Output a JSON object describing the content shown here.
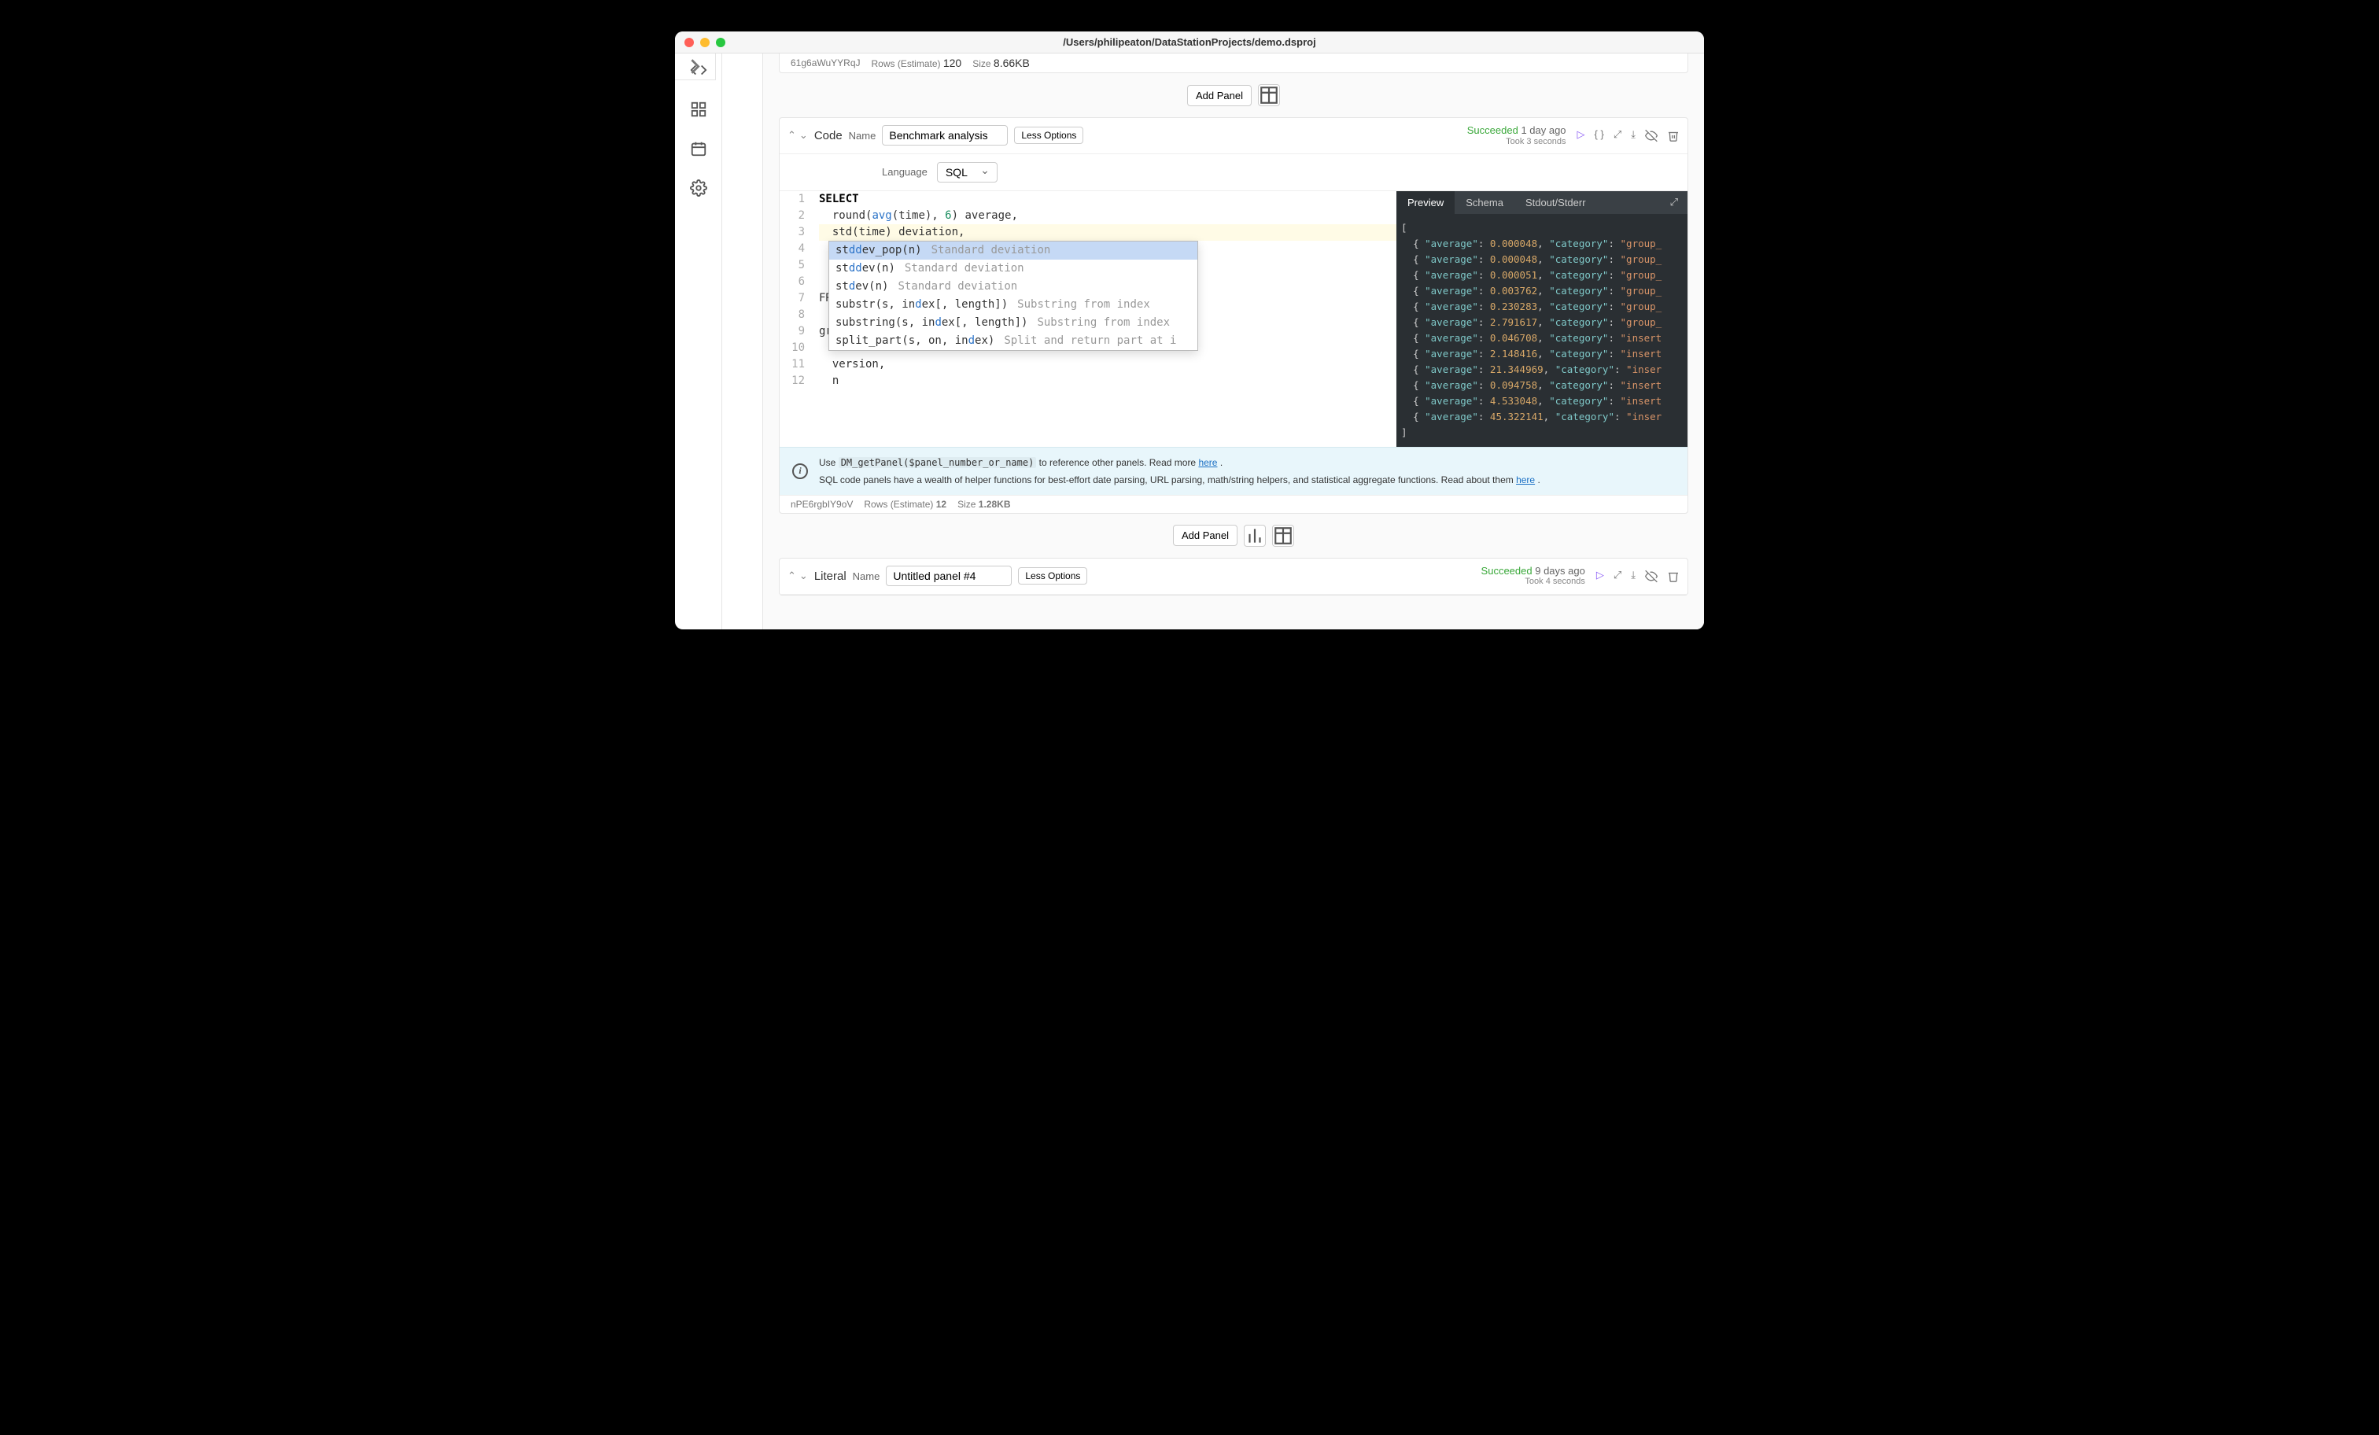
{
  "window_title": "/Users/philipeaton/DataStationProjects/demo.dsproj",
  "sidebar": {
    "icons": [
      "code-icon",
      "grid-icon",
      "calendar-icon",
      "gear-icon"
    ]
  },
  "prev_panel_footer": {
    "id": "61g6aWuYYRqJ",
    "rows_label": "Rows (Estimate)",
    "rows": "120",
    "size_label": "Size",
    "size": "8.66KB"
  },
  "add_panel_label": "Add Panel",
  "panel1": {
    "kind": "Code",
    "name_label": "Name",
    "name": "Benchmark analysis",
    "less_options": "Less Options",
    "status_ok": "Succeeded",
    "status_when": "1 day ago",
    "status_sub": "Took 3 seconds",
    "language_label": "Language",
    "language": "SQL",
    "code_lines": [
      "SELECT",
      "  round(avg(time), 6) average,",
      "  std(time) deviation,",
      "",
      "",
      "",
      "FR",
      "",
      "gr",
      "",
      "  version,",
      "  n"
    ],
    "autocomplete": [
      {
        "sig": "stddev_pop(n)",
        "match": "std",
        "desc": "Standard deviation"
      },
      {
        "sig": "stddev(n)",
        "match": "std",
        "desc": "Standard deviation"
      },
      {
        "sig": "stdev(n)",
        "match": "st",
        "desc": "Standard deviation"
      },
      {
        "sig": "substr(s, index[, length])",
        "match": "",
        "desc": "Substring from index"
      },
      {
        "sig": "substring(s, index[, length])",
        "match": "",
        "desc": "Substring from index"
      },
      {
        "sig": "split_part(s, on, index)",
        "match": "",
        "desc": "Split and return part at i"
      }
    ],
    "info1_pre": "Use ",
    "info1_code": "DM_getPanel($panel_number_or_name)",
    "info1_post": " to reference other panels. Read more ",
    "info1_link": "here",
    "info2": "SQL code panels have a wealth of helper functions for best-effort date parsing, URL parsing, math/string helpers, and statistical aggregate functions. Read about them ",
    "info2_link": "here",
    "preview_tabs": [
      "Preview",
      "Schema",
      "Stdout/Stderr"
    ],
    "preview_data": [
      {
        "average": 4.8e-05,
        "category": "group_"
      },
      {
        "average": 4.8e-05,
        "category": "group_"
      },
      {
        "average": 5.1e-05,
        "category": "group_"
      },
      {
        "average": 0.003762,
        "category": "group_"
      },
      {
        "average": 0.230283,
        "category": "group_"
      },
      {
        "average": 2.791617,
        "category": "group_"
      },
      {
        "average": 0.046708,
        "category": "insert"
      },
      {
        "average": 2.148416,
        "category": "insert"
      },
      {
        "average": 21.344969,
        "category": "inser"
      },
      {
        "average": 0.094758,
        "category": "insert"
      },
      {
        "average": 4.533048,
        "category": "insert"
      },
      {
        "average": 45.322141,
        "category": "inser"
      }
    ],
    "footer": {
      "id": "nPE6rgbIY9oV",
      "rows_label": "Rows (Estimate)",
      "rows": "12",
      "size_label": "Size",
      "size": "1.28KB"
    }
  },
  "panel2": {
    "kind": "Literal",
    "name_label": "Name",
    "name": "Untitled panel #4",
    "less_options": "Less Options",
    "status_ok": "Succeeded",
    "status_when": "9 days ago",
    "status_sub": "Took 4 seconds"
  }
}
